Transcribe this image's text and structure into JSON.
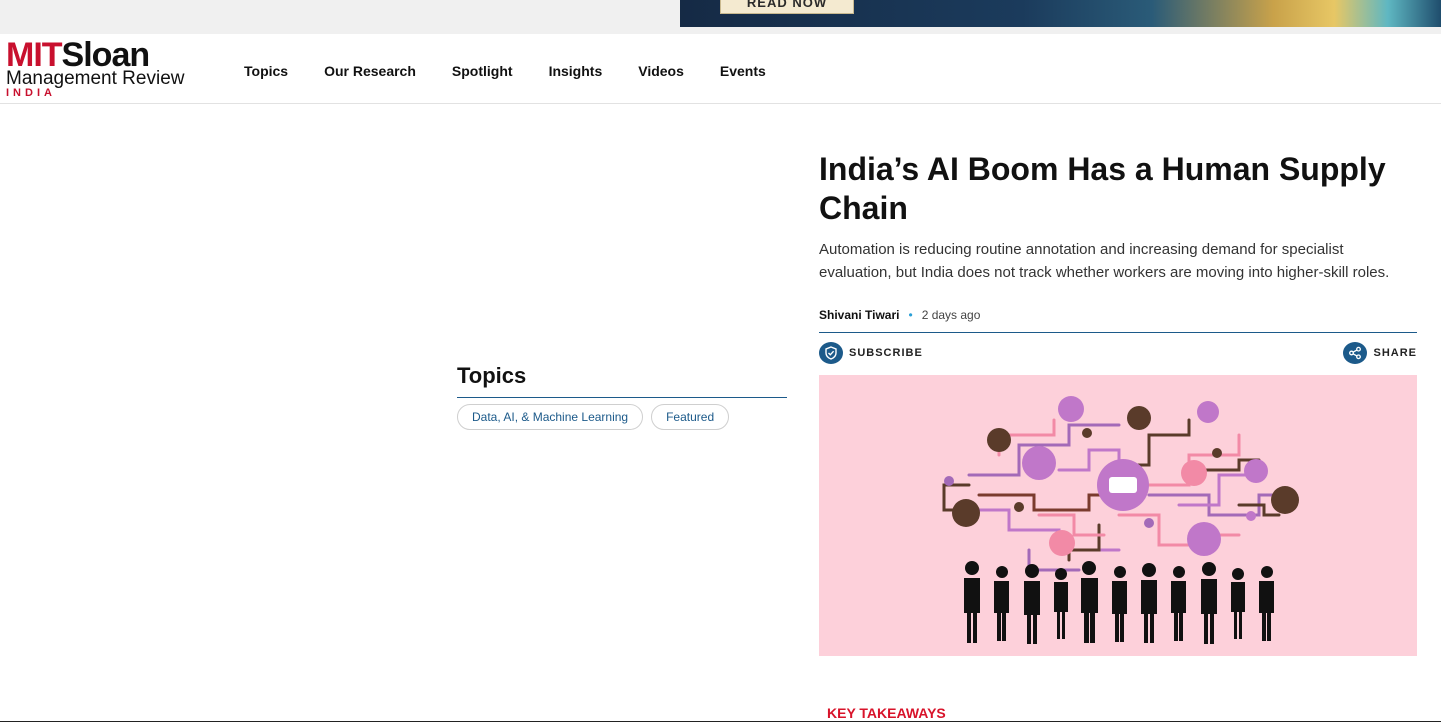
{
  "ad": {
    "button_label": "READ NOW"
  },
  "logo": {
    "mit": "MIT",
    "sloan": "Sloan",
    "line2": "Management Review",
    "line3": "INDIA"
  },
  "nav": {
    "items": [
      "Topics",
      "Our Research",
      "Spotlight",
      "Insights",
      "Videos",
      "Events"
    ]
  },
  "topics": {
    "title": "Topics",
    "tags": [
      "Data, AI, & Machine Learning",
      "Featured"
    ]
  },
  "article": {
    "headline": "India’s AI Boom Has a Human Supply Chain",
    "dek": "Automation is reducing routine annotation and increasing demand for specialist evaluation, but India does not track whether workers are moving into higher-skill roles.",
    "author": "Shivani Tiwari",
    "time": "2 days ago",
    "subscribe_label": "SUBSCRIBE",
    "share_label": "SHARE",
    "key_takeaways": "KEY TAKEAWAYS"
  },
  "colors": {
    "brand_red": "#c8102e",
    "brand_blue": "#1c5a8a",
    "hero_bg": "#fdd0da"
  }
}
